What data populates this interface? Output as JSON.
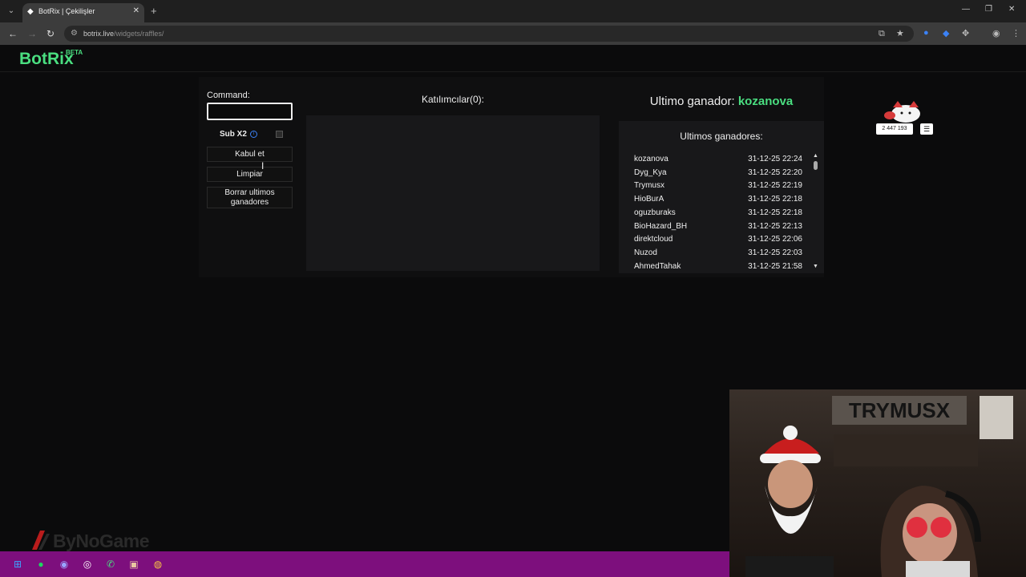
{
  "browser": {
    "tab_title": "BotRix | Çekilişler",
    "tab_menu_icon": "chevron-down-icon",
    "url_domain": "botrix.live",
    "url_path": "/widgets/raffles/"
  },
  "site": {
    "logo": "BotRix",
    "logo_badge": "BETA"
  },
  "raffle": {
    "command_label": "Command:",
    "command_value": "",
    "sub_label": "Sub X2",
    "sub_checked": false,
    "accept_label": "Kabul et",
    "clear_label": "Limpiar",
    "erase_label": "Borrar ultimos ganadores",
    "participants_label": "Katılımcılar(0):"
  },
  "winners": {
    "last_winner_label": "Ultimo ganador:",
    "last_winner_name": "kozanova",
    "list_title": "Ultimos ganadores:",
    "items": [
      {
        "name": "kozanova",
        "date": "31-12-25 22:24"
      },
      {
        "name": "Dyg_Kya",
        "date": "31-12-25 22:20"
      },
      {
        "name": "Trymusx",
        "date": "31-12-25 22:19"
      },
      {
        "name": "HioBurA",
        "date": "31-12-25 22:18"
      },
      {
        "name": "oguzburaks",
        "date": "31-12-25 22:18"
      },
      {
        "name": "BioHazard_BH",
        "date": "31-12-25 22:13"
      },
      {
        "name": "direktcloud",
        "date": "31-12-25 22:06"
      },
      {
        "name": "Nuzod",
        "date": "31-12-25 22:03"
      },
      {
        "name": "AhmedTahak",
        "date": "31-12-25 21:58"
      }
    ]
  },
  "mascot": {
    "count": "2 447 193"
  },
  "overlay": {
    "webcam_banner": "TRYMUSX",
    "watermark": "ByNoGame"
  },
  "colors": {
    "accent": "#4ade80",
    "taskbar": "#7d0f7d",
    "info": "#3b82f6"
  }
}
